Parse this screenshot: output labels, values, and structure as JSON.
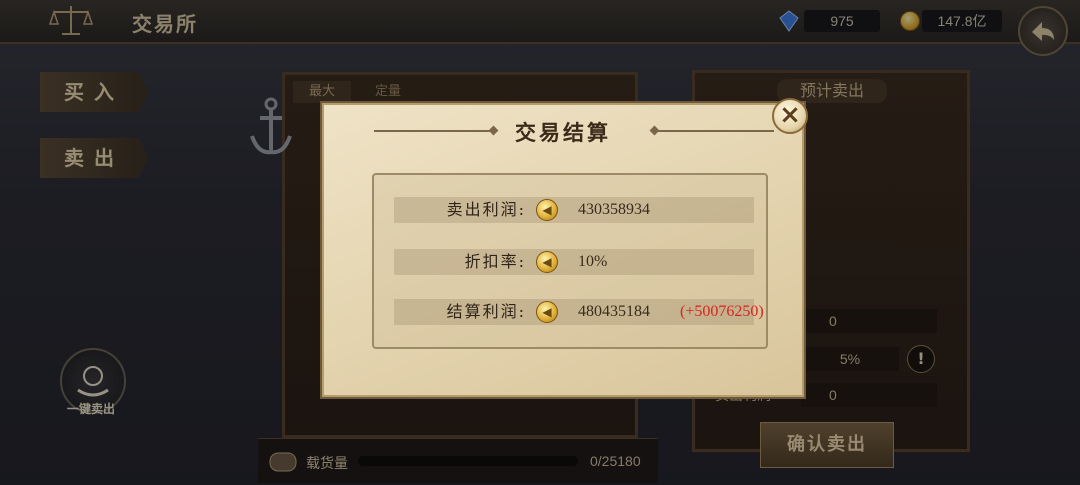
{
  "header": {
    "title": "交易所",
    "gems": "975",
    "coins": "147.8亿"
  },
  "left_tabs": [
    "买入",
    "卖出"
  ],
  "shelf_tabs": [
    "最大",
    "定量"
  ],
  "one_click_sell": "一键卖出",
  "cargo": {
    "label": "载货量",
    "value": "0/25180",
    "fill": 0.0
  },
  "right_panel": {
    "title": "预计卖出",
    "rows": [
      "0",
      "5%",
      "0"
    ],
    "row3_label": "卖出利润",
    "confirm": "确认卖出"
  },
  "modal": {
    "title": "交易结算",
    "close": "×",
    "rows": [
      {
        "label": "卖出利润:",
        "value": "430358934",
        "bonus": ""
      },
      {
        "label": "折扣率:",
        "value": "10%",
        "bonus": ""
      },
      {
        "label": "结算利润:",
        "value": "480435184",
        "bonus": "(+50076250)"
      }
    ]
  },
  "colors": {
    "accent": "#d8241e",
    "parchment": "#e8dab8"
  },
  "icons": [
    "scales-icon",
    "gem-icon",
    "coin-icon",
    "back-arrow-icon",
    "anchor-icon",
    "coins-sack-icon",
    "close-icon",
    "barrel-icon",
    "warning-icon"
  ]
}
